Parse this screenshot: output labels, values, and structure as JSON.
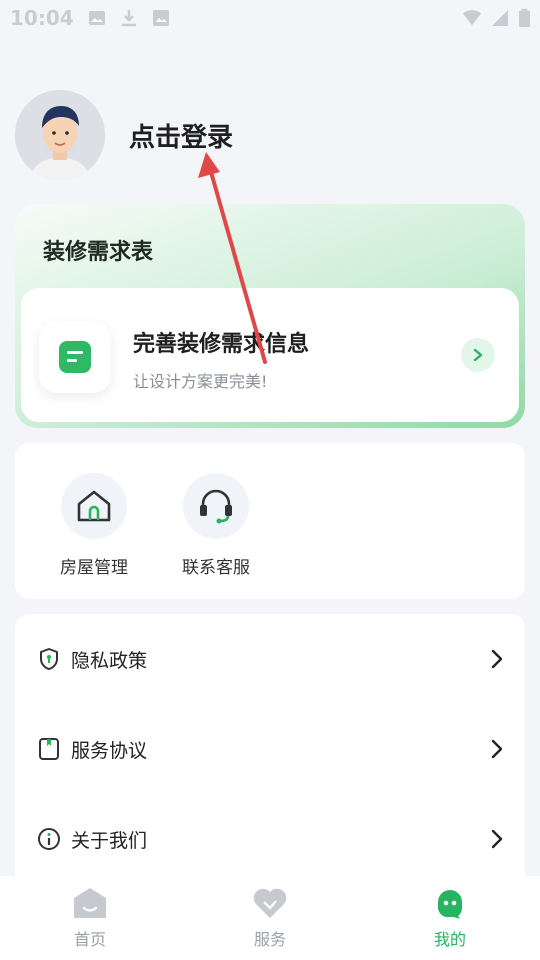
{
  "status_bar": {
    "time": "10:04"
  },
  "profile": {
    "login_text": "点击登录"
  },
  "demand": {
    "title": "装修需求表",
    "main_text": "完善装修需求信息",
    "sub_text": "让设计方案更完美!"
  },
  "shortcuts": [
    {
      "label": "房屋管理",
      "icon": "house-icon"
    },
    {
      "label": "联系客服",
      "icon": "headset-icon"
    }
  ],
  "menu": [
    {
      "label": "隐私政策",
      "icon": "shield-icon"
    },
    {
      "label": "服务协议",
      "icon": "document-icon"
    },
    {
      "label": "关于我们",
      "icon": "info-icon"
    }
  ],
  "tabs": [
    {
      "label": "首页",
      "icon": "home-icon",
      "active": false
    },
    {
      "label": "服务",
      "icon": "heart-icon",
      "active": false
    },
    {
      "label": "我的",
      "icon": "mascot-icon",
      "active": true
    }
  ],
  "colors": {
    "accent": "#27b35f",
    "annotation_arrow": "#e04848"
  }
}
